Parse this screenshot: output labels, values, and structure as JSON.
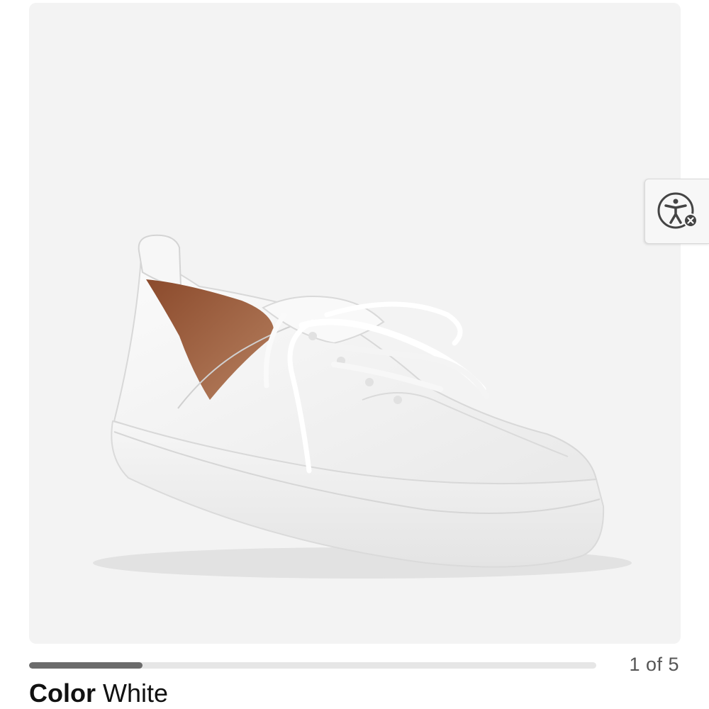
{
  "gallery": {
    "image_alt": "White leather lace-up sneaker",
    "current": 1,
    "total": 5,
    "counter_text": "1 of 5",
    "progress": 0.2
  },
  "accessibility_button": {
    "icon": "accessibility-icon",
    "badge_icon": "close-icon"
  },
  "product": {
    "color_label": "Color",
    "color_value": "White"
  },
  "colors": {
    "gallery_bg": "#f3f3f3",
    "progress_track": "#e6e6e6",
    "progress_fill": "#6b6b6b",
    "text": "#111111",
    "counter_text": "#555555"
  }
}
